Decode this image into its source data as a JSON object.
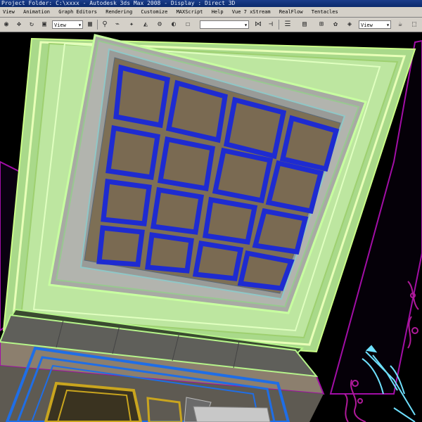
{
  "title_bar": {
    "text": "Project Folder: C:\\xxxx     - Autodesk 3ds Max 2008     - Display : Direct 3D"
  },
  "menu": {
    "items": [
      "View",
      "Animation",
      "Graph Editors",
      "Rendering",
      "Customize",
      "MAXScript",
      "Help",
      "Vue 7 xStream",
      "RealFlow",
      "Tentacles"
    ]
  },
  "toolbar": {
    "reference_coord_select": "View",
    "named_selection_input": "",
    "render_type_select": "View"
  },
  "viewport": {
    "label": "",
    "colors": {
      "background": "#000000",
      "wireframe_green": "#b6f58a",
      "coffer_blue": "#1e2bd1",
      "magenta_edge": "#a20ea6",
      "floor_blue": "#1f6ee6",
      "gold": "#c9a51e",
      "cyan_fixture": "#6fe0ff"
    }
  }
}
